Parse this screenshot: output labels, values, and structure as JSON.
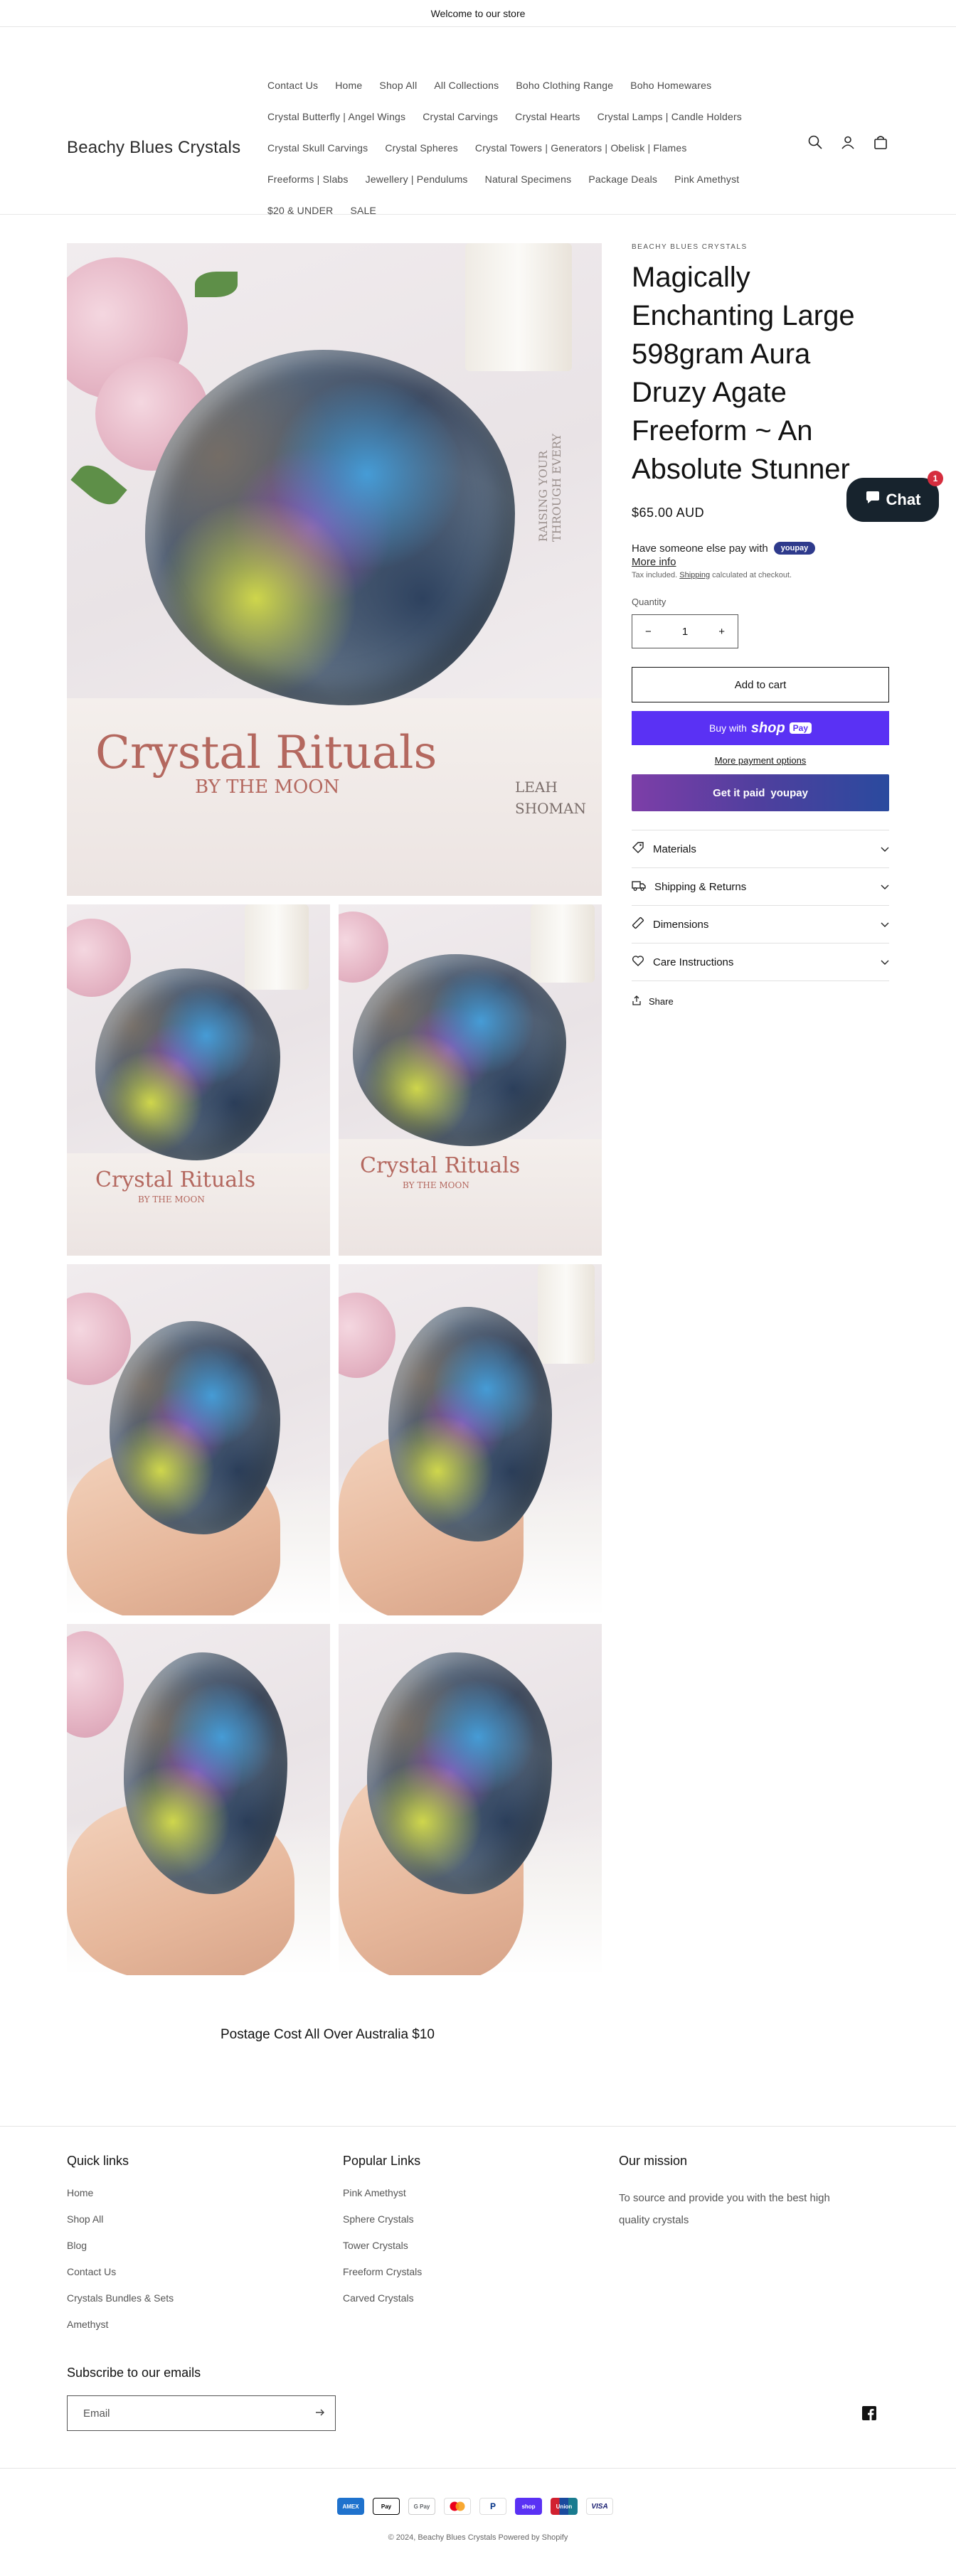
{
  "announcement": "Welcome to our store",
  "store_name": "Beachy Blues Crystals",
  "nav": {
    "rows": [
      [
        "Contact Us",
        "Home",
        "Shop All",
        "All Collections",
        "Boho Clothing Range",
        "Boho Homewares"
      ],
      [
        "Crystal Butterfly | Angel Wings",
        "Crystal Carvings",
        "Crystal Hearts",
        "Crystal Lamps | Candle Holders"
      ],
      [
        "Crystal Skull Carvings",
        "Crystal Spheres",
        "Crystal Towers | Generators | Obelisk | Flames"
      ],
      [
        "Freeforms | Slabs",
        "Jewellery | Pendulums",
        "Natural Specimens",
        "Package Deals",
        "Pink Amethyst"
      ],
      [
        "$20 & UNDER",
        "SALE"
      ]
    ]
  },
  "header_icons": [
    "search-icon",
    "account-icon",
    "cart-icon"
  ],
  "gallery": {
    "main_book_title": "Crystal Rituals",
    "main_book_subtitle": "BY THE MOON",
    "main_book_author": "LEAH SHOMAN",
    "main_book_spine": "RAISING YOUR THROUGH EVERY",
    "thumb_book_title": "Crystal Rituals",
    "thumb_book_subtitle": "BY THE MOON"
  },
  "product": {
    "vendor": "BEACHY BLUES CRYSTALS",
    "title": "Magically Enchanting Large 598gram Aura Druzy Agate Freeform ~ An Absolute Stunner",
    "price": "$65.00 AUD",
    "youpay_text": "Have someone else pay with",
    "youpay_badge": "youpay",
    "more_info": "More info",
    "tax_prefix": "Tax included.",
    "tax_link": "Shipping",
    "tax_suffix": "calculated at checkout.",
    "quantity_label": "Quantity",
    "quantity_value": "1",
    "minus": "−",
    "plus": "+",
    "add_to_cart": "Add to cart",
    "buy_with": "Buy with",
    "shop_word": "shop",
    "pay_word": "Pay",
    "more_payment": "More payment options",
    "youpay_button_left": "Get it paid",
    "youpay_button_right": "youpay",
    "collapsibles": [
      {
        "label": "Materials",
        "icon": "tag-icon"
      },
      {
        "label": "Shipping & Returns",
        "icon": "truck-icon"
      },
      {
        "label": "Dimensions",
        "icon": "ruler-icon"
      },
      {
        "label": "Care Instructions",
        "icon": "heart-icon"
      }
    ],
    "share": "Share"
  },
  "chat": {
    "label": "Chat",
    "badge": "1"
  },
  "postage": "Postage Cost All Over Australia $10",
  "footer": {
    "quick_links_title": "Quick links",
    "quick_links": [
      "Home",
      "Shop All",
      "Blog",
      "Contact Us",
      "Crystals Bundles & Sets",
      "Amethyst"
    ],
    "popular_title": "Popular Links",
    "popular_links": [
      "Pink Amethyst",
      "Sphere Crystals",
      "Tower Crystals",
      "Freeform Crystals",
      "Carved Crystals"
    ],
    "mission_title": "Our mission",
    "mission_text": "To source and provide you with the best high quality crystals",
    "subscribe_title": "Subscribe to our emails",
    "email_placeholder": "Email",
    "payments": [
      {
        "label": "AMEX",
        "color": "#1f72cd"
      },
      {
        "label": "Pay",
        "color": "#000000"
      },
      {
        "label": "G Pay",
        "color": "#ffffff"
      },
      {
        "label": "MC",
        "color": "#ffffff"
      },
      {
        "label": "P",
        "color": "#ffffff"
      },
      {
        "label": "shop",
        "color": "#5a31f4"
      },
      {
        "label": "Union",
        "color": "#1a7b8f"
      },
      {
        "label": "VISA",
        "color": "#ffffff"
      }
    ],
    "copyright_prefix": "© 2024,",
    "copyright_store": "Beachy Blues Crystals",
    "copyright_suffix": "Powered by Shopify"
  },
  "colors": {
    "shop_pay": "#5a31f4",
    "chat_bg": "#17232d",
    "chat_badge": "#d62d3e",
    "youpay_badge": "#2e3a8c"
  }
}
